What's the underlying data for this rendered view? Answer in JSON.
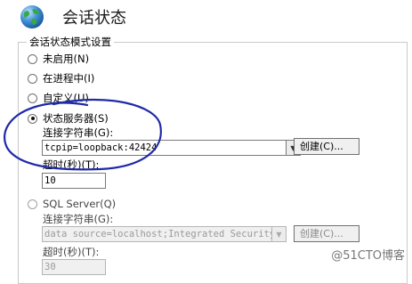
{
  "header": {
    "title": "会话状态"
  },
  "group": {
    "legend": "会话状态模式设置"
  },
  "modes": {
    "not_enabled": "未启用(N)",
    "in_process": "在进程中(I)",
    "custom": "自定义(U)",
    "state_server": "状态服务器(S)",
    "sql_server": "SQL Server(Q)"
  },
  "state_server": {
    "connstr_label": "连接字符串(G):",
    "connstr_value": "tcpip=loopback:42424",
    "create_label": "创建(C)...",
    "timeout_label": "超时(秒)(T):",
    "timeout_value": "10"
  },
  "sql_server": {
    "connstr_label": "连接字符串(G):",
    "connstr_value": "data source=localhost;Integrated Security=S",
    "create_label": "创建(C)...",
    "timeout_label": "超时(秒)(T):",
    "timeout_value": "30"
  },
  "watermark": "@51CTO博客",
  "colors": {
    "annotation": "#1f2aa8"
  }
}
